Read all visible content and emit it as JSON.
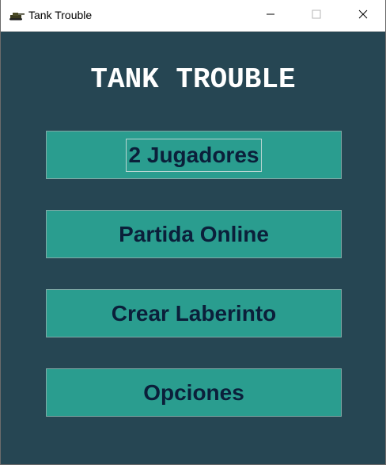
{
  "window": {
    "title": "Tank Trouble",
    "icon": "tank-icon",
    "controls": [
      "minimize-icon",
      "maximize-icon",
      "close-icon"
    ]
  },
  "game": {
    "title": "TANK TROUBLE"
  },
  "menu": {
    "items": [
      {
        "label": "2 Jugadores",
        "focused": true
      },
      {
        "label": "Partida Online",
        "focused": false
      },
      {
        "label": "Crear Laberinto",
        "focused": false
      },
      {
        "label": "Opciones",
        "focused": false
      }
    ]
  },
  "colors": {
    "background": "#264653",
    "button": "#2a9d8f",
    "button_text": "#0b1f3a",
    "title_text": "#ffffff"
  }
}
